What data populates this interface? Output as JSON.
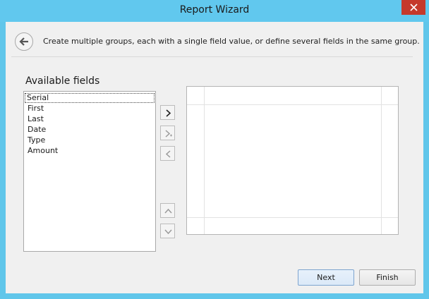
{
  "window": {
    "title": "Report Wizard",
    "close_label": "✕"
  },
  "page": {
    "description": "Create multiple groups, each with a single field value, or define several fields in the same group."
  },
  "available_fields": {
    "label": "Available fields",
    "items": [
      "Serial",
      "First",
      "Last",
      "Date",
      "Type",
      "Amount"
    ],
    "selected": "Serial"
  },
  "buttons": {
    "next": "Next",
    "finish": "Finish"
  },
  "colors": {
    "titlebar": "#61c8ee",
    "close": "#c5392b",
    "client": "#f0f0f0"
  }
}
